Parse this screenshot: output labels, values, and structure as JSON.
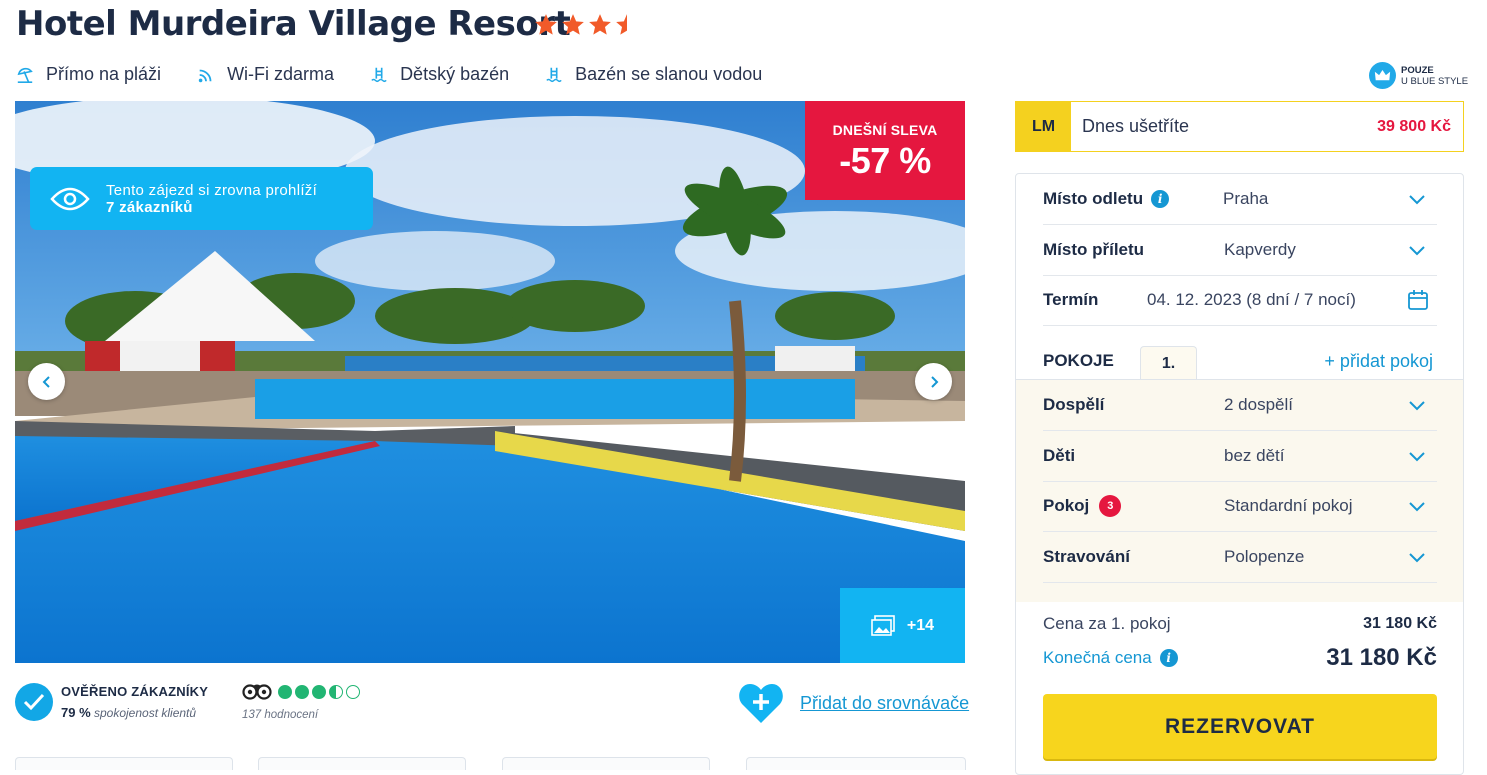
{
  "hotel": {
    "name": "Hotel Murdeira Village Resort",
    "stars": 3.5
  },
  "amenities": [
    {
      "icon": "beach-umbrella-icon",
      "label": "Přímo na pláži"
    },
    {
      "icon": "wifi-icon",
      "label": "Wi-Fi zdarma"
    },
    {
      "icon": "pool-ladder-icon",
      "label": "Dětský bazén"
    },
    {
      "icon": "pool-ladder-icon",
      "label": "Bazén se slanou vodou"
    }
  ],
  "badge": {
    "line1": "POUZE",
    "line2": "U BLUE STYLE"
  },
  "gallery": {
    "viewers_line1": "Tento zájezd si zrovna prohlíží",
    "viewers_line2": "7 zákazníků",
    "sale_label": "DNEŠNÍ SLEVA",
    "sale_value": "-57 %",
    "more_photos": "+14"
  },
  "reviews": {
    "verified_title": "OVĚŘENO ZÁKAZNÍKY",
    "satisfaction_value": "79 %",
    "satisfaction_text": "spokojenost klientů",
    "tripadvisor_rating": 3.5,
    "tripadvisor_count": "137 hodnocení"
  },
  "compare_link": "Přidat do srovnávače",
  "lastminute": {
    "badge": "LM",
    "label": "Dnes ušetříte",
    "amount": "39 800 Kč"
  },
  "form": {
    "departure": {
      "label": "Místo odletu",
      "value": "Praha"
    },
    "arrival": {
      "label": "Místo příletu",
      "value": "Kapverdy"
    },
    "term": {
      "label": "Termín",
      "value": "04. 12. 2023 (8 dní / 7 nocí)"
    },
    "rooms": {
      "label": "POKOJE",
      "tab": "1.",
      "add": "+ přidat pokoj"
    },
    "adults": {
      "label": "Dospělí",
      "value": "2 dospělí"
    },
    "children": {
      "label": "Děti",
      "value": "bez dětí"
    },
    "room": {
      "label": "Pokoj",
      "badge": "3",
      "value": "Standardní pokoj"
    },
    "board": {
      "label": "Stravování",
      "value": "Polopenze"
    }
  },
  "price": {
    "per_room_label": "Cena za 1. pokoj",
    "per_room_value": "31 180 Kč",
    "final_label": "Konečná cena",
    "final_value": "31 180 Kč"
  },
  "reserve_button": "REZERVOVAT",
  "colors": {
    "brand_blue": "#12b4f2",
    "sale_red": "#e5173f",
    "accent_yellow": "#f7d51d",
    "star_orange": "#f15a29"
  }
}
